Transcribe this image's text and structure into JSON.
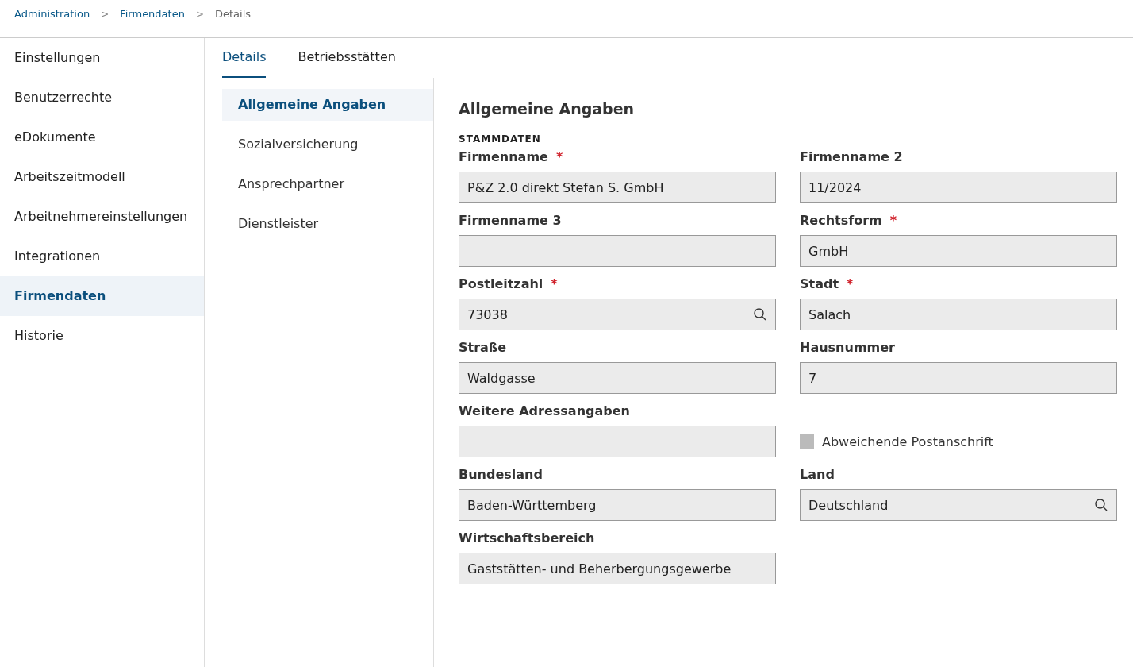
{
  "breadcrumb": [
    {
      "label": "Administration",
      "current": false
    },
    {
      "label": "Firmendaten",
      "current": false
    },
    {
      "label": "Details",
      "current": true
    }
  ],
  "breadcrumb_separator": ">",
  "sidebar": {
    "items": [
      {
        "label": "Einstellungen",
        "selected": false
      },
      {
        "label": "Benutzerrechte",
        "selected": false
      },
      {
        "label": "eDokumente",
        "selected": false
      },
      {
        "label": "Arbeitszeitmodell",
        "selected": false
      },
      {
        "label": "Arbeitnehmereinstellungen",
        "selected": false
      },
      {
        "label": "Integrationen",
        "selected": false
      },
      {
        "label": "Firmendaten",
        "selected": true
      },
      {
        "label": "Historie",
        "selected": false
      }
    ]
  },
  "tabs": [
    {
      "label": "Details",
      "selected": true
    },
    {
      "label": "Betriebsstätten",
      "selected": false
    }
  ],
  "subnav": {
    "items": [
      {
        "label": "Allgemeine Angaben",
        "selected": true
      },
      {
        "label": "Sozialversicherung",
        "selected": false
      },
      {
        "label": "Ansprechpartner",
        "selected": false
      },
      {
        "label": "Dienstleister",
        "selected": false
      }
    ]
  },
  "form": {
    "title": "Allgemeine Angaben",
    "section": "STAMMDATEN",
    "required_mark": "*",
    "items": [
      {
        "kind": "field",
        "label": "Firmenname",
        "required": true,
        "value": "P&Z 2.0 direkt Stefan S. GmbH",
        "search": false
      },
      {
        "kind": "field",
        "label": "Firmenname 2",
        "required": false,
        "value": "11/2024",
        "search": false
      },
      {
        "kind": "field",
        "label": "Firmenname 3",
        "required": false,
        "search": false
      },
      {
        "kind": "field",
        "label": "Rechtsform",
        "required": true,
        "value": "GmbH",
        "search": false
      },
      {
        "kind": "field",
        "label": "Postleitzahl",
        "required": true,
        "value": "73038",
        "search": true
      },
      {
        "kind": "field",
        "label": "Stadt",
        "required": true,
        "value": "Salach",
        "search": false
      },
      {
        "kind": "field",
        "label": "Straße",
        "required": false,
        "value": "Waldgasse",
        "search": false
      },
      {
        "kind": "field",
        "label": "Hausnummer",
        "required": false,
        "value": "7",
        "search": false
      },
      {
        "kind": "field",
        "label": "Weitere Adressangaben",
        "required": false,
        "search": false
      },
      {
        "kind": "checkbox",
        "label": "Abweichende Postanschrift",
        "checked": false
      },
      {
        "kind": "field",
        "label": "Bundesland",
        "required": false,
        "value": "Baden-Württemberg",
        "search": false
      },
      {
        "kind": "field",
        "label": "Land",
        "required": false,
        "value": "Deutschland",
        "search": true
      },
      {
        "kind": "field",
        "label": "Wirtschaftsbereich",
        "required": false,
        "value": "Gaststätten- und Beherbergungsgewerbe",
        "search": false
      }
    ]
  }
}
